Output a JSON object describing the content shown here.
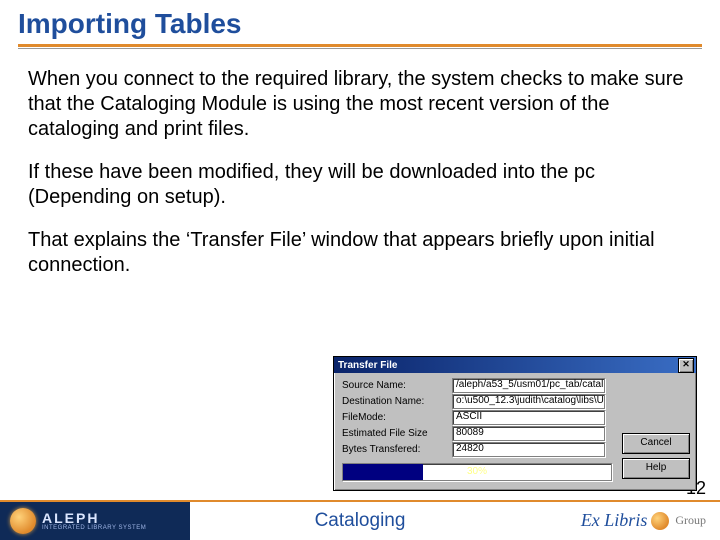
{
  "title": "Importing Tables",
  "paragraphs": {
    "p1": "When you connect to the required library, the system checks to make sure that the Cataloging Module is using the most recent version of the cataloging and print files.",
    "p2": "If these have been modified, they will be downloaded into the pc (Depending on setup).",
    "p3": " That explains the ‘Transfer File’ window that appears briefly upon initial connection."
  },
  "page_number": "12",
  "footer": {
    "brand_main": "ALEPH",
    "brand_sub": "INTEGRATED LIBRARY SYSTEM",
    "center": "Cataloging",
    "right_brand": "Ex Libris",
    "right_suffix": "Group"
  },
  "dialog": {
    "title": "Transfer File",
    "close_glyph": "✕",
    "labels": {
      "source": "Source Name:",
      "dest": "Destination Name:",
      "mode": "FileMode:",
      "size": "Estimated File Size",
      "bytes": "Bytes Transfered:"
    },
    "values": {
      "source": "/aleph/a53_5/usm01/pc_tab/catal",
      "dest": "o:\\u500_12.3\\judith\\catalog\\libs\\U",
      "mode": "ASCII",
      "size": "80089",
      "bytes": "24820"
    },
    "buttons": {
      "cancel": "Cancel",
      "help": "Help"
    },
    "progress": {
      "percent": 30,
      "label": "30%"
    }
  }
}
